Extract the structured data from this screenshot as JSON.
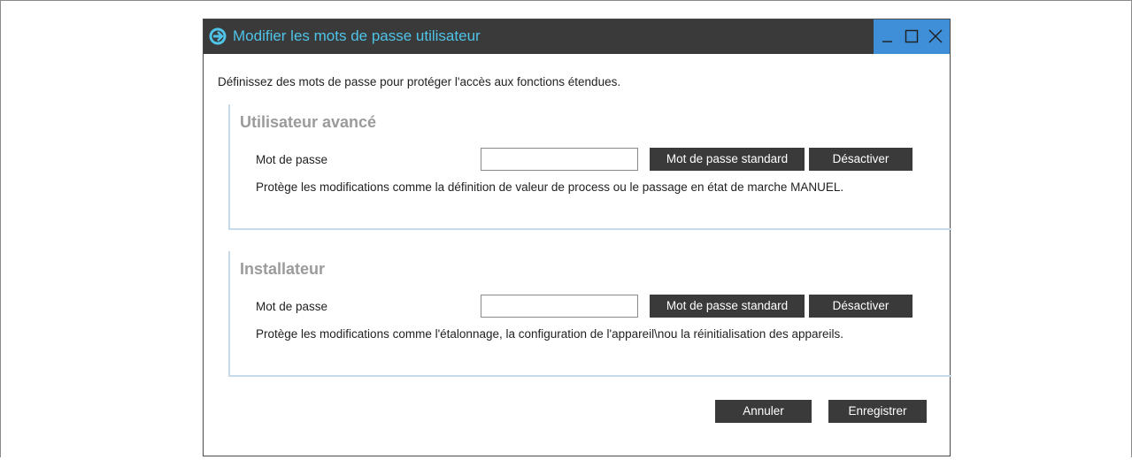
{
  "window": {
    "title": "Modifier les mots de passe utilisateur",
    "title_color": "#4fc3e8",
    "titlebar_color": "#3a3a3a",
    "controls_color": "#3f8fd8",
    "icons": {
      "app": "app-logo-icon",
      "minimize": "minimize-icon",
      "maximize": "maximize-icon",
      "close": "close-icon"
    }
  },
  "intro_text": "Définissez des mots de passe pour protéger l'accès aux fonctions étendues.",
  "sections": [
    {
      "title": "Utilisateur avancé",
      "field_label": "Mot de passe",
      "password_value": "",
      "standard_button": "Mot de passe standard",
      "disable_button": "Désactiver",
      "description": "Protège les modifications comme la définition de valeur de process ou le passage en état de marche MANUEL."
    },
    {
      "title": "Installateur",
      "field_label": "Mot de passe",
      "password_value": "",
      "standard_button": "Mot de passe standard",
      "disable_button": "Désactiver",
      "description": "Protège les modifications comme l'étalonnage, la configuration de l'appareil\\nou la réinitialisation des appareils."
    }
  ],
  "footer": {
    "cancel_label": "Annuler",
    "save_label": "Enregistrer"
  },
  "colors": {
    "button_bg": "#3a3a3a",
    "section_border": "#c8d9e8",
    "section_title": "#9b9b9b"
  }
}
